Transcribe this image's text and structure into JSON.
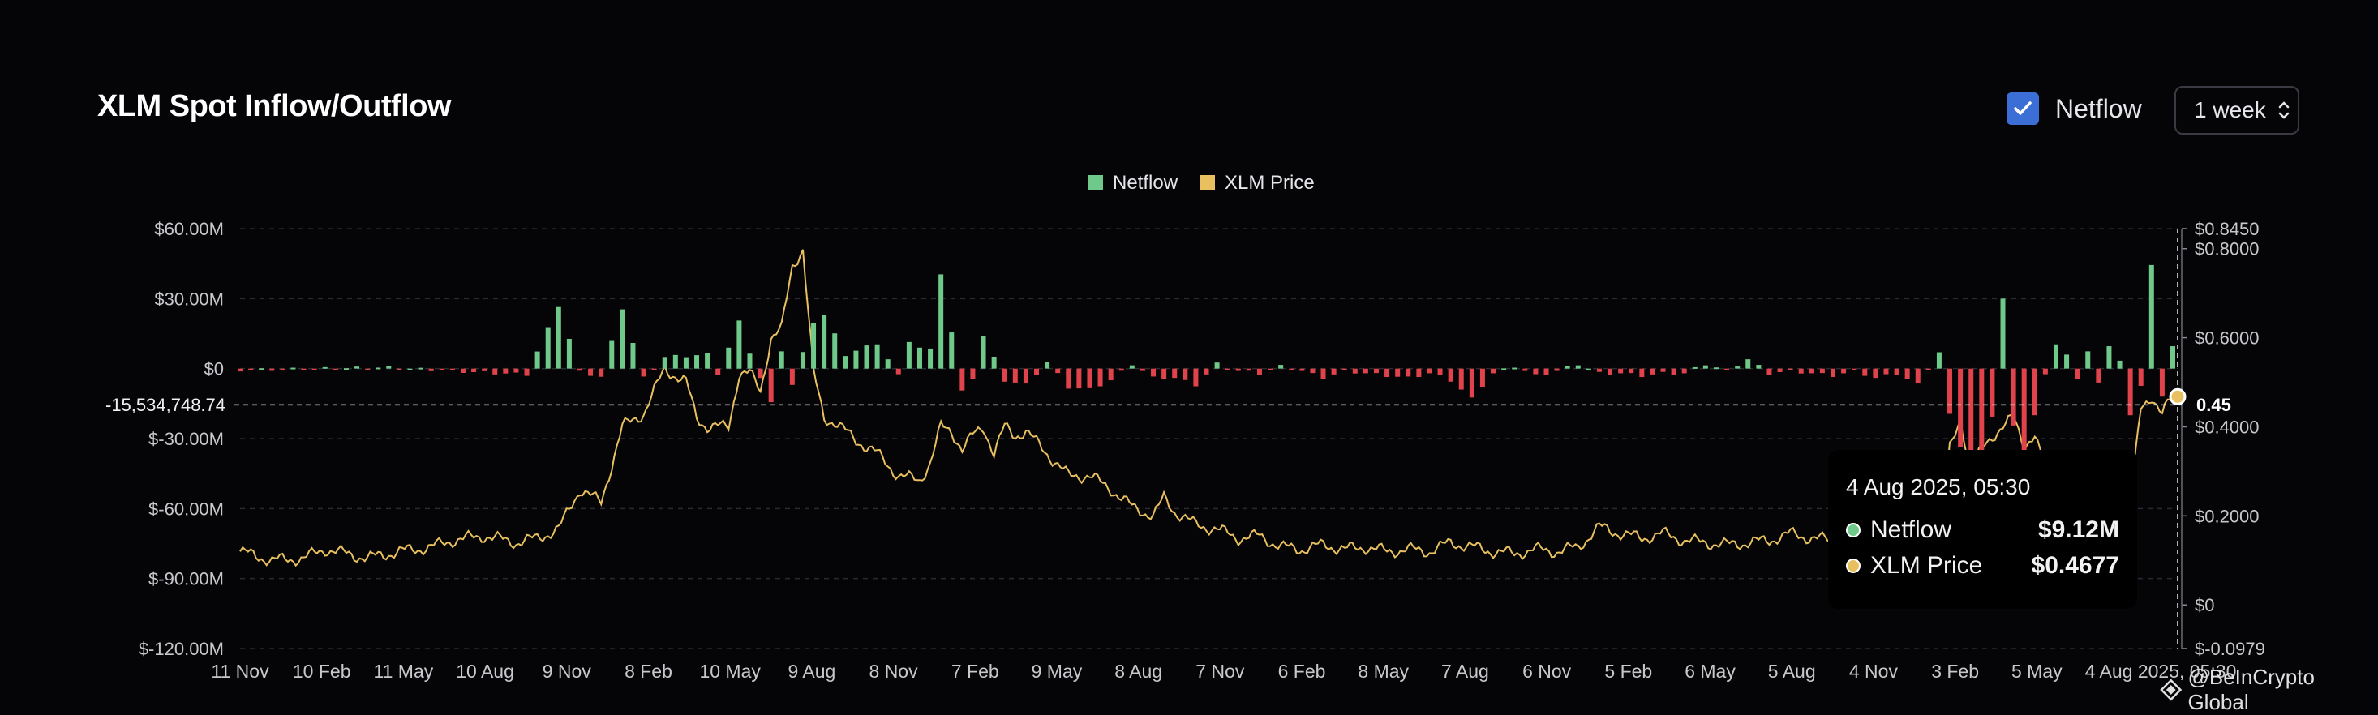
{
  "header": {
    "title": "XLM Spot Inflow/Outflow",
    "netflow_toggle_label": "Netflow",
    "netflow_checked": true,
    "period_select": "1 week"
  },
  "legend": [
    {
      "label": "Netflow",
      "color": "#6ec98a"
    },
    {
      "label": "XLM Price",
      "color": "#e8c060"
    }
  ],
  "crosshair": {
    "left_value": "-15,534,748.74",
    "right_value": "0.45",
    "x_label": "4 Aug 2025, 05:30"
  },
  "tooltip": {
    "time": "4 Aug 2025, 05:30",
    "rows": [
      {
        "name": "Netflow",
        "value": "$9.12M",
        "color": "#6ec98a"
      },
      {
        "name": "XLM Price",
        "value": "$0.4677",
        "color": "#e8c060"
      }
    ]
  },
  "watermark": "@BeInCrypto Global",
  "colors": {
    "positive": "#6ec98a",
    "negative": "#e0434b",
    "price": "#e8c060",
    "grid": "#2a2b30"
  },
  "chart_data": {
    "type": "bar",
    "title": "XLM Spot Inflow/Outflow",
    "x_tick_labels": [
      "11 Nov",
      "10 Feb",
      "11 May",
      "10 Aug",
      "9 Nov",
      "8 Feb",
      "10 May",
      "9 Aug",
      "8 Nov",
      "7 Feb",
      "9 May",
      "8 Aug",
      "7 Nov",
      "6 Feb",
      "8 May",
      "7 Aug",
      "6 Nov",
      "5 Feb",
      "6 May",
      "5 Aug",
      "4 Nov",
      "3 Feb",
      "5 May",
      "4 Aug 2025, 05:30"
    ],
    "left_axis": {
      "ticks": [
        "$60.00M",
        "$30.00M",
        "$0",
        "$-30.00M",
        "$-60.00M",
        "$-90.00M",
        "$-120.00M"
      ],
      "tick_values": [
        60,
        30,
        0,
        -30,
        -60,
        -90,
        -120
      ],
      "range": [
        -120,
        60
      ],
      "unit": "M USD"
    },
    "right_axis": {
      "ticks": [
        "$0.8450",
        "$0.8000",
        "$0.6000",
        "$0.4000",
        "$0.2000",
        "$0",
        "$-0.0979"
      ],
      "tick_values": [
        0.845,
        0.8,
        0.6,
        0.4,
        0.2,
        0,
        -0.0979
      ],
      "range": [
        -0.0979,
        0.845
      ]
    },
    "netflow_anchors": [
      [
        0,
        -0.6
      ],
      [
        14,
        0.5
      ],
      [
        22,
        -1.5
      ],
      [
        27,
        -2.5
      ],
      [
        30,
        27
      ],
      [
        32,
        -1.5
      ],
      [
        34,
        -3.5
      ],
      [
        36,
        26
      ],
      [
        38,
        -4
      ],
      [
        40,
        5
      ],
      [
        44,
        6
      ],
      [
        45,
        -2
      ],
      [
        47,
        20
      ],
      [
        48,
        7
      ],
      [
        50,
        -15
      ],
      [
        51,
        8
      ],
      [
        52,
        -7
      ],
      [
        54,
        20
      ],
      [
        55,
        23
      ],
      [
        57,
        6
      ],
      [
        60,
        11
      ],
      [
        62,
        -3
      ],
      [
        63,
        12
      ],
      [
        64,
        9
      ],
      [
        65,
        8
      ],
      [
        66,
        41
      ],
      [
        68,
        -10
      ],
      [
        69,
        -4
      ],
      [
        70,
        14
      ],
      [
        72,
        -5
      ],
      [
        74,
        -7
      ],
      [
        76,
        3
      ],
      [
        78,
        -8
      ],
      [
        80,
        -9
      ],
      [
        82,
        -5
      ],
      [
        84,
        2
      ],
      [
        86,
        -4
      ],
      [
        88,
        -4
      ],
      [
        90,
        -7
      ],
      [
        92,
        2
      ],
      [
        94,
        -1
      ],
      [
        96,
        -2
      ],
      [
        98,
        1
      ],
      [
        100,
        -1
      ],
      [
        102,
        -4
      ],
      [
        104,
        -1
      ],
      [
        106,
        -2
      ],
      [
        108,
        -3
      ],
      [
        110,
        -4
      ],
      [
        112,
        -2
      ],
      [
        114,
        -5
      ],
      [
        116,
        -13
      ],
      [
        118,
        -2
      ],
      [
        120,
        1
      ],
      [
        122,
        -3
      ],
      [
        124,
        -1
      ],
      [
        126,
        2
      ],
      [
        128,
        -2
      ],
      [
        130,
        -2
      ],
      [
        132,
        -3
      ],
      [
        134,
        -2
      ],
      [
        136,
        -2
      ],
      [
        138,
        2
      ],
      [
        140,
        -1
      ],
      [
        142,
        4
      ],
      [
        144,
        -2
      ],
      [
        146,
        -1
      ],
      [
        148,
        -2
      ],
      [
        150,
        -3
      ],
      [
        152,
        -1
      ],
      [
        154,
        -4
      ],
      [
        156,
        -2
      ],
      [
        158,
        -7
      ],
      [
        160,
        7
      ],
      [
        161,
        -20
      ],
      [
        162,
        -33
      ],
      [
        163,
        -95
      ],
      [
        164,
        -52
      ],
      [
        165,
        -20
      ],
      [
        166,
        30
      ],
      [
        167,
        -25
      ],
      [
        168,
        -37
      ],
      [
        169,
        -20
      ],
      [
        170,
        -3
      ],
      [
        171,
        11
      ],
      [
        172,
        6
      ],
      [
        173,
        -5
      ],
      [
        174,
        8
      ],
      [
        175,
        -6
      ],
      [
        176,
        9
      ],
      [
        177,
        4
      ],
      [
        178,
        -20
      ],
      [
        179,
        -8
      ],
      [
        180,
        45
      ],
      [
        181,
        -12
      ],
      [
        182,
        9
      ]
    ],
    "bar_count": 183,
    "price_anchors": [
      [
        0,
        0.12
      ],
      [
        3,
        0.1
      ],
      [
        6,
        0.105
      ],
      [
        8,
        0.125
      ],
      [
        10,
        0.115
      ],
      [
        12,
        0.105
      ],
      [
        15,
        0.12
      ],
      [
        18,
        0.13
      ],
      [
        20,
        0.145
      ],
      [
        23,
        0.155
      ],
      [
        26,
        0.14
      ],
      [
        28,
        0.15
      ],
      [
        30,
        0.17
      ],
      [
        32,
        0.26
      ],
      [
        34,
        0.23
      ],
      [
        36,
        0.4
      ],
      [
        38,
        0.43
      ],
      [
        40,
        0.53
      ],
      [
        42,
        0.5
      ],
      [
        43,
        0.42
      ],
      [
        44,
        0.4
      ],
      [
        46,
        0.4
      ],
      [
        47,
        0.52
      ],
      [
        48,
        0.52
      ],
      [
        49,
        0.48
      ],
      [
        50,
        0.6
      ],
      [
        51,
        0.62
      ],
      [
        52,
        0.76
      ],
      [
        53,
        0.8
      ],
      [
        54,
        0.52
      ],
      [
        55,
        0.42
      ],
      [
        56,
        0.41
      ],
      [
        58,
        0.37
      ],
      [
        60,
        0.34
      ],
      [
        62,
        0.29
      ],
      [
        64,
        0.28
      ],
      [
        65,
        0.32
      ],
      [
        66,
        0.4
      ],
      [
        67,
        0.39
      ],
      [
        68,
        0.35
      ],
      [
        69,
        0.38
      ],
      [
        70,
        0.4
      ],
      [
        71,
        0.34
      ],
      [
        72,
        0.4
      ],
      [
        73,
        0.38
      ],
      [
        74,
        0.39
      ],
      [
        76,
        0.34
      ],
      [
        78,
        0.29
      ],
      [
        80,
        0.29
      ],
      [
        82,
        0.26
      ],
      [
        84,
        0.22
      ],
      [
        86,
        0.2
      ],
      [
        87,
        0.24
      ],
      [
        88,
        0.21
      ],
      [
        90,
        0.18
      ],
      [
        92,
        0.17
      ],
      [
        94,
        0.15
      ],
      [
        96,
        0.155
      ],
      [
        98,
        0.13
      ],
      [
        100,
        0.125
      ],
      [
        102,
        0.135
      ],
      [
        104,
        0.125
      ],
      [
        106,
        0.13
      ],
      [
        108,
        0.12
      ],
      [
        110,
        0.125
      ],
      [
        112,
        0.12
      ],
      [
        114,
        0.14
      ],
      [
        116,
        0.13
      ],
      [
        118,
        0.12
      ],
      [
        120,
        0.115
      ],
      [
        122,
        0.125
      ],
      [
        124,
        0.12
      ],
      [
        126,
        0.13
      ],
      [
        128,
        0.175
      ],
      [
        130,
        0.16
      ],
      [
        132,
        0.15
      ],
      [
        134,
        0.16
      ],
      [
        136,
        0.145
      ],
      [
        138,
        0.14
      ],
      [
        140,
        0.135
      ],
      [
        142,
        0.14
      ],
      [
        144,
        0.145
      ],
      [
        146,
        0.16
      ],
      [
        148,
        0.15
      ],
      [
        150,
        0.145
      ],
      [
        152,
        0.14
      ],
      [
        154,
        0.13
      ],
      [
        156,
        0.135
      ],
      [
        158,
        0.125
      ],
      [
        160,
        0.12
      ],
      [
        161,
        0.35
      ],
      [
        162,
        0.42
      ],
      [
        163,
        0.3
      ],
      [
        164,
        0.35
      ],
      [
        165,
        0.38
      ],
      [
        166,
        0.4
      ],
      [
        167,
        0.42
      ],
      [
        168,
        0.36
      ],
      [
        169,
        0.38
      ],
      [
        170,
        0.3
      ],
      [
        172,
        0.28
      ],
      [
        174,
        0.28
      ],
      [
        176,
        0.25
      ],
      [
        178,
        0.23
      ],
      [
        179,
        0.44
      ],
      [
        180,
        0.47
      ],
      [
        181,
        0.43
      ],
      [
        182,
        0.4677
      ]
    ]
  }
}
